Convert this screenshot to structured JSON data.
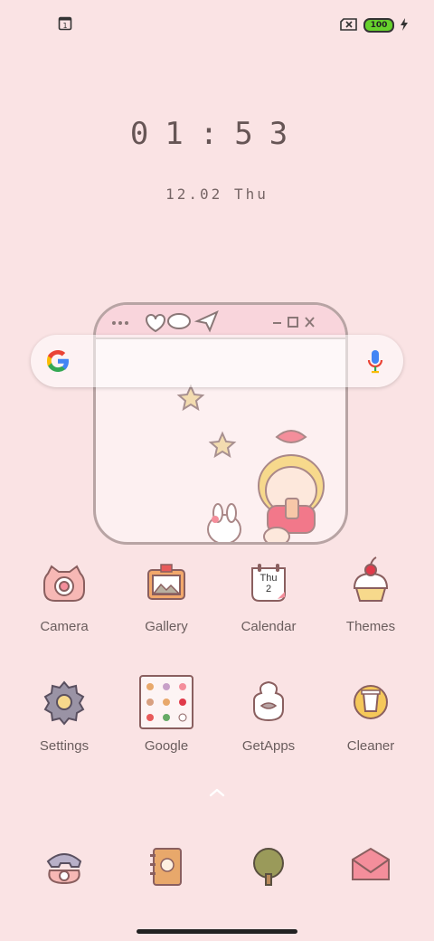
{
  "status": {
    "battery": "100",
    "left_icon": "calendar-notification-icon",
    "right_icons": [
      "no-sim-icon",
      "battery-icon",
      "charging-icon"
    ]
  },
  "clock": {
    "time": "01:53",
    "date": "12.02 Thu"
  },
  "search": {
    "icons": [
      "google-logo-icon",
      "microphone-icon"
    ]
  },
  "apps": [
    {
      "label": "Camera",
      "icon": "camera-icon"
    },
    {
      "label": "Gallery",
      "icon": "gallery-icon"
    },
    {
      "label": "Calendar",
      "icon": "calendar-icon",
      "calendar_day": "Thu",
      "calendar_date": "2"
    },
    {
      "label": "Themes",
      "icon": "themes-icon"
    },
    {
      "label": "Settings",
      "icon": "settings-icon"
    },
    {
      "label": "Google",
      "icon": "google-folder-icon"
    },
    {
      "label": "GetApps",
      "icon": "getapps-icon"
    },
    {
      "label": "Cleaner",
      "icon": "cleaner-icon"
    }
  ],
  "dock": [
    "phone-icon",
    "contacts-icon",
    "browser-icon",
    "messages-icon"
  ],
  "colors": {
    "background": "#fae3e4",
    "accent": "#f7a6b0"
  }
}
